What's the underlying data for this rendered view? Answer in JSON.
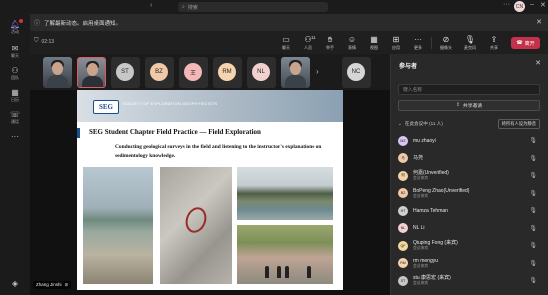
{
  "titlebar": {
    "search_placeholder": "搜索",
    "avatar_initials": "CN",
    "back": "‹",
    "more": "···"
  },
  "rail": [
    {
      "label": "活动",
      "icon": "bell-icon"
    },
    {
      "label": "聊天",
      "icon": "chat-icon"
    },
    {
      "label": "团队",
      "icon": "teams-icon"
    },
    {
      "label": "日历",
      "icon": "calendar-icon"
    },
    {
      "label": "通话",
      "icon": "phone-icon"
    },
    {
      "label": "",
      "icon": "more-icon"
    },
    {
      "label": "",
      "icon": "apps-icon"
    }
  ],
  "banner": {
    "text": "了解最新动态。启用桌面通知。",
    "close": "✕"
  },
  "meeting": {
    "timer": "02:13",
    "toolbar": [
      {
        "label": "聊天",
        "icon": "chat-icon"
      },
      {
        "label": "人员",
        "icon": "people-icon",
        "count": "11"
      },
      {
        "label": "举手",
        "icon": "raise-hand-icon"
      },
      {
        "label": "表情",
        "icon": "reaction-icon"
      },
      {
        "label": "视图",
        "icon": "view-icon"
      },
      {
        "label": "应用",
        "icon": "apps-icon"
      },
      {
        "label": "更多",
        "icon": "more-icon"
      },
      {
        "label": "摄像头",
        "icon": "camera-off-icon"
      },
      {
        "label": "麦克风",
        "icon": "mic-icon"
      },
      {
        "label": "共享",
        "icon": "share-icon"
      }
    ],
    "leave_label": "离开"
  },
  "strip": [
    {
      "type": "video"
    },
    {
      "type": "video",
      "selected": true
    },
    {
      "type": "avatar",
      "initials": "ST",
      "color": "#c7c7c7"
    },
    {
      "type": "avatar",
      "initials": "BZ",
      "color": "#f0c9a9"
    },
    {
      "type": "avatar",
      "initials": "王",
      "color": "#f4b8b8"
    },
    {
      "type": "avatar",
      "initials": "RM",
      "color": "#f6d4b0"
    },
    {
      "type": "avatar",
      "initials": "NL",
      "color": "#f1d0d0"
    },
    {
      "type": "video"
    },
    {
      "type": "avatar",
      "initials": "NC",
      "color": "#d6d6d6"
    }
  ],
  "slide": {
    "logo": "SEG",
    "society": "SOCIETY OF EXPLORATION GEOPHYSICISTS",
    "title": "SEG Student Chapter Field Practice — Field Exploration",
    "body": "Conducting geological surveys in the field and listening to the instructor's explanations on sedimentology knowledge."
  },
  "presenter": {
    "name": "Zhang Jinshi",
    "icon": "mic-off-icon"
  },
  "panel": {
    "title": "参与者",
    "search_placeholder": "键入名称",
    "share_invite": "共享邀请",
    "section": "在此会议中 (11 人)",
    "mute_all": "将所有人设为静音",
    "participants": [
      {
        "initials": "MZ",
        "name": "mu zhaoyi",
        "sub": "",
        "color": "#d8c7f0"
      },
      {
        "initials": "马",
        "name": "马尧",
        "sub": "",
        "color": "#f0c9a9"
      },
      {
        "initials": "何",
        "name": "何嘉(Unverified)",
        "sub": "会议来宾",
        "color": "#f4d4a6"
      },
      {
        "initials": "BZ",
        "name": "BoPeng Zhao(Unverified)",
        "sub": "会议来宾",
        "color": "#f0c9a9"
      },
      {
        "initials": "HT",
        "name": "Hamza Tehman",
        "sub": "",
        "color": "#d0d0d0"
      },
      {
        "initials": "NL",
        "name": "NL Li",
        "sub": "",
        "color": "#f1d0d0"
      },
      {
        "initials": "QF",
        "name": "Qiuping Fong (来宾)",
        "sub": "会议来宾",
        "color": "#f3d8a2"
      },
      {
        "initials": "RM",
        "name": "rm mengyu",
        "sub": "会议来宾",
        "color": "#f6d4b0"
      },
      {
        "initials": "ST",
        "name": "stu 康思宏 (来宾)",
        "sub": "会议来宾",
        "color": "#c7c7c7"
      }
    ]
  }
}
